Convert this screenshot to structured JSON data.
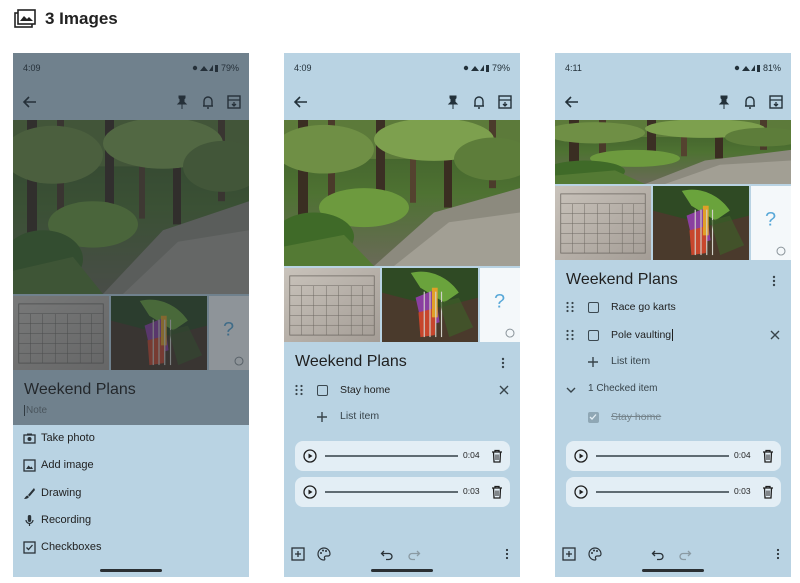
{
  "header": {
    "title": "3 Images"
  },
  "colors": {
    "phone_bg": "#b9d3e3",
    "audio_bg": "#e3eef5",
    "dim_overlay": "#283038"
  },
  "phones": [
    {
      "time": "4:09",
      "battery": "79%",
      "note_title": "Weekend Plans",
      "note_placeholder": "Note",
      "menu": [
        {
          "label": "Take photo",
          "icon": "camera-icon"
        },
        {
          "label": "Add image",
          "icon": "image-icon"
        },
        {
          "label": "Drawing",
          "icon": "brush-icon"
        },
        {
          "label": "Recording",
          "icon": "mic-icon"
        },
        {
          "label": "Checkboxes",
          "icon": "checkbox-icon"
        }
      ]
    },
    {
      "time": "4:09",
      "battery": "79%",
      "note_title": "Weekend Plans",
      "items": [
        {
          "label": "Stay home",
          "checked": false
        }
      ],
      "add_item_label": "List item",
      "recordings": [
        {
          "time": "0:04"
        },
        {
          "time": "0:03"
        }
      ]
    },
    {
      "time": "4:11",
      "battery": "81%",
      "note_title": "Weekend Plans",
      "items": [
        {
          "label": "Race go karts",
          "checked": false
        },
        {
          "label": "Pole vaulting",
          "checked": false
        }
      ],
      "add_item_label": "List item",
      "checked_header": "1 Checked item",
      "checked_items": [
        {
          "label": "Stay home",
          "checked": true
        }
      ],
      "recordings": [
        {
          "time": "0:04"
        },
        {
          "time": "0:03"
        }
      ]
    }
  ]
}
